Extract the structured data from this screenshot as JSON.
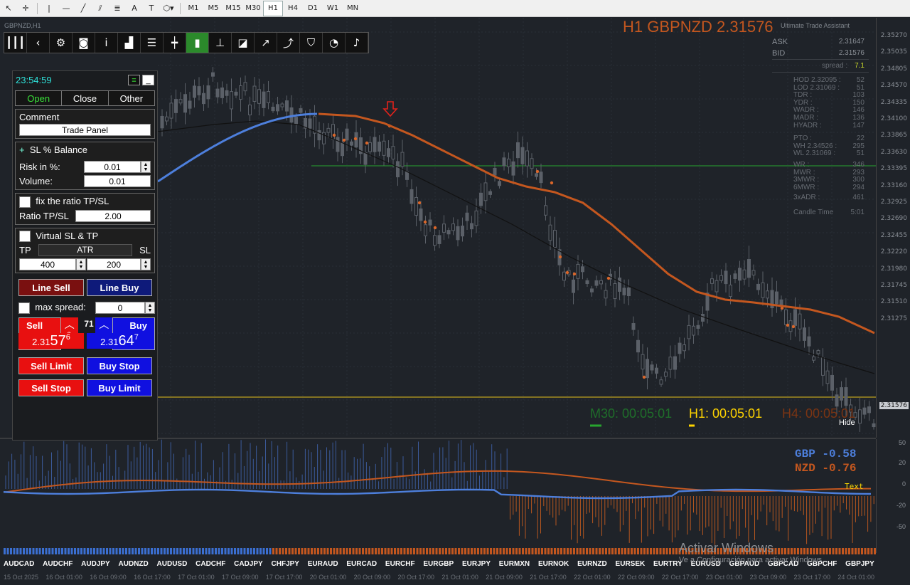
{
  "window": {
    "chart_label": "GBPNZD,H1",
    "title": "H1 GBPNZD 2.31576"
  },
  "toolbar": {
    "timeframes": [
      "M1",
      "M5",
      "M15",
      "M30",
      "H1",
      "H4",
      "D1",
      "W1",
      "MN"
    ],
    "active_timeframe": "H1"
  },
  "price_axis": [
    "2.35270",
    "2.35035",
    "2.34805",
    "2.34570",
    "2.34335",
    "2.34100",
    "2.33865",
    "2.33630",
    "2.33395",
    "2.33160",
    "2.32925",
    "2.32690",
    "2.32455",
    "2.32220",
    "2.31980",
    "2.31745",
    "2.31510",
    "2.31275"
  ],
  "current_price": "2.31576",
  "assistant": {
    "title": "Ultimate Trade Assistant",
    "ask_label": "ASK",
    "ask": "2.31647",
    "bid_label": "BID",
    "bid": "2.31576",
    "spread_label": "spread :",
    "spread": "7.1",
    "stats": [
      {
        "k": "HOD 2.32095 :",
        "v": "52"
      },
      {
        "k": "LOD 2.31069 :",
        "v": "51"
      },
      {
        "k": "TDR :",
        "v": "103"
      },
      {
        "k": "YDR :",
        "v": "150"
      },
      {
        "k": "WADR :",
        "v": "146"
      },
      {
        "k": "MADR :",
        "v": "136"
      },
      {
        "k": "HYADR :",
        "v": "147"
      },
      {
        "k": "PTO :",
        "v": "22"
      },
      {
        "k": "WH 2.34526 :",
        "v": "295"
      },
      {
        "k": "WL 2.31069 :",
        "v": "51"
      },
      {
        "k": "WR :",
        "v": "346"
      },
      {
        "k": "MWR :",
        "v": "293"
      },
      {
        "k": "3MWR :",
        "v": "300"
      },
      {
        "k": "6MWR :",
        "v": "294"
      },
      {
        "k": "3xADR :",
        "v": "461"
      },
      {
        "k": "Candle Time",
        "v": "5:01"
      }
    ]
  },
  "panel": {
    "clock": "23:54:59",
    "tabs": [
      "Open",
      "Close",
      "Other"
    ],
    "comment_label": "Comment",
    "comment_value": "Trade Panel",
    "sl_mode": "SL % Balance",
    "risk_label": "Risk in %:",
    "risk_value": "0.01",
    "volume_label": "Volume:",
    "volume_value": "0.01",
    "fix_ratio_label": "fix the ratio TP/SL",
    "ratio_label": "Ratio TP/SL",
    "ratio_value": "2.00",
    "virtual_label": "Virtual SL & TP",
    "tp_label": "TP",
    "atr_label": "ATR",
    "sl_label": "SL",
    "tp_value": "400",
    "sl_value": "200",
    "line_sell": "Line Sell",
    "line_buy": "Line Buy",
    "max_spread_label": "max spread:",
    "max_spread_value": "0",
    "sell_label": "Sell",
    "buy_label": "Buy",
    "spread_points": "71",
    "sell_price_small": "2.31",
    "sell_price_big": "57",
    "sell_price_pip": "6",
    "buy_price_small": "2.31",
    "buy_price_big": "64",
    "buy_price_pip": "7",
    "sell_limit": "Sell Limit",
    "buy_stop": "Buy Stop",
    "sell_stop": "Sell Stop",
    "buy_limit": "Buy Limit"
  },
  "timers": {
    "m30": "M30: 00:05:01",
    "h1": "H1: 00:05:01",
    "h4": "H4: 00:05:01"
  },
  "hide_label": "Hide",
  "indicator": {
    "gbp": "GBP -0.58",
    "nzd": "NZD -0.76",
    "text_label": "Text",
    "axis": [
      "50",
      "20",
      "0",
      "-20",
      "-50"
    ]
  },
  "pairs": [
    "AUDCAD",
    "AUDCHF",
    "AUDJPY",
    "AUDNZD",
    "AUDUSD",
    "CADCHF",
    "CADJPY",
    "CHFJPY",
    "EURAUD",
    "EURCAD",
    "EURCHF",
    "EURGBP",
    "EURJPY",
    "EURMXN",
    "EURNOK",
    "EURNZD",
    "EURSEK",
    "EURTRY",
    "EURUSD",
    "GBPAUD",
    "GBPCAD",
    "GBPCHF",
    "GBPJPY"
  ],
  "dates": [
    "15 Oct 2025",
    "16 Oct 01:00",
    "16 Oct 09:00",
    "16 Oct 17:00",
    "17 Oct 01:00",
    "17 Oct 09:00",
    "17 Oct 17:00",
    "20 Oct 01:00",
    "20 Oct 09:00",
    "20 Oct 17:00",
    "21 Oct 01:00",
    "21 Oct 09:00",
    "21 Oct 17:00",
    "22 Oct 01:00",
    "22 Oct 09:00",
    "22 Oct 17:00",
    "23 Oct 01:00",
    "23 Oct 09:00",
    "23 Oct 17:00",
    "24 Oct 01:00"
  ],
  "watermark": {
    "line1": "Activar Windows",
    "line2": "Ve a Configuración para activar Windows."
  },
  "colors": {
    "accent_orange": "#c4571f",
    "accent_blue": "#4d7fdc",
    "background": "#1f2329"
  }
}
